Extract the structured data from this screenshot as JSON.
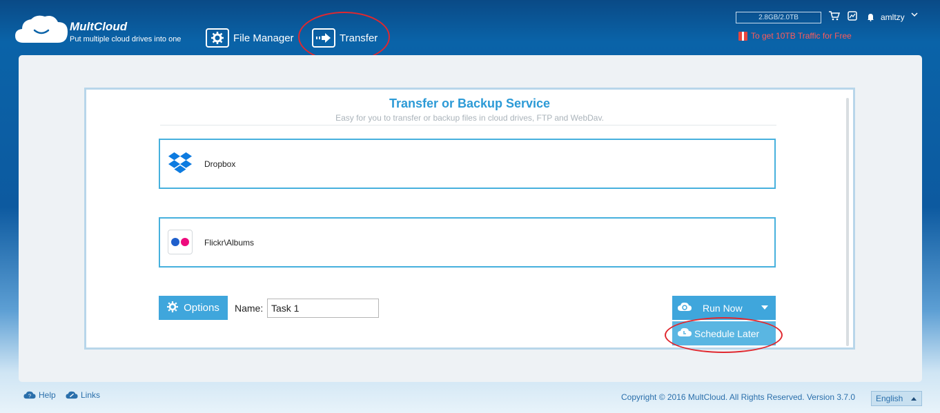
{
  "header": {
    "brand": "MultCloud",
    "tagline": "Put multiple cloud drives into one",
    "nav": [
      {
        "label": "File Manager",
        "icon": "gear-icon"
      },
      {
        "label": "Transfer",
        "icon": "arrow-right-icon"
      }
    ],
    "storage": "2.8GB/2.0TB",
    "username": "amltzy",
    "promo": "To get 10TB Traffic for Free"
  },
  "transfer": {
    "title": "Transfer or Backup Service",
    "subtitle": "Easy for you to transfer or backup files in cloud drives, FTP and WebDav.",
    "source": {
      "label": "Dropbox",
      "icon": "dropbox-icon"
    },
    "destination": {
      "label": "Flickr\\Albums",
      "icon": "flickr-icon"
    },
    "options_label": "Options",
    "name_label": "Name:",
    "task_name": "Task 1",
    "run_label": "Run Now",
    "schedule_label": "Schedule Later"
  },
  "footer": {
    "help": "Help",
    "links": "Links",
    "copyright": "Copyright © 2016 MultCloud. All Rights Reserved. Version 3.7.0",
    "language": "English"
  },
  "colors": {
    "accent": "#3fa6dc",
    "title": "#2c9ad6",
    "promo": "#ff5a5a",
    "highlight": "#e0282f"
  }
}
